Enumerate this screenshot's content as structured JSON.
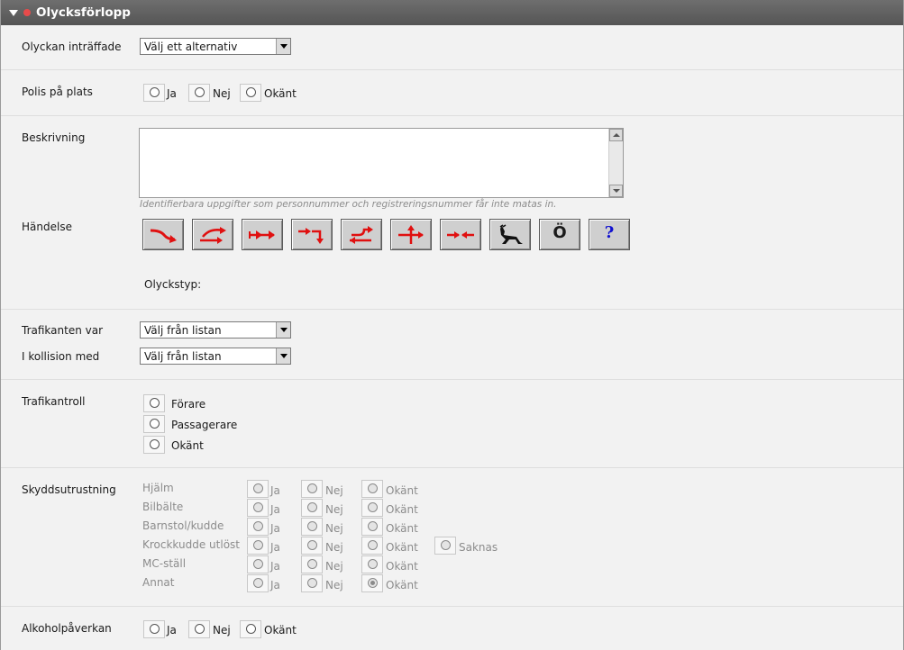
{
  "panel": {
    "title": "Olycksförlopp"
  },
  "incident": {
    "label": "Olyckan inträffade",
    "select_value": "Välj ett alternativ"
  },
  "police": {
    "label": "Polis på plats",
    "options": [
      "Ja",
      "Nej",
      "Okänt"
    ]
  },
  "description": {
    "label": "Beskrivning",
    "value": "",
    "hint": "Identifierbara uppgifter som personnummer och registreringsnummer får inte matas in."
  },
  "event": {
    "label": "Händelse",
    "buttons": [
      "turn-right-icon",
      "overtake-icon",
      "same-direction-icon",
      "turn-down-icon",
      "u-turn-icon",
      "crossing-icon",
      "head-on-icon",
      "deer-icon",
      "o-umlaut-icon",
      "question-icon"
    ],
    "glyph_o": "Ö",
    "glyph_q": "?",
    "type_label": "Olyckstyp:",
    "arrow_color": "#e01010"
  },
  "traffic_party": {
    "label": "Trafikanten var",
    "select_value": "Välj från listan"
  },
  "collision": {
    "label": "I kollision med",
    "select_value": "Välj från listan"
  },
  "traffic_control": {
    "label": "Trafikantroll",
    "options": [
      "Förare",
      "Passagerare",
      "Okänt"
    ]
  },
  "protection": {
    "label": "Skyddsutrustning",
    "options": [
      "Ja",
      "Nej",
      "Okänt"
    ],
    "missing_label": "Saknas",
    "rows": [
      "Hjälm",
      "Bilbälte",
      "Barnstol/kudde",
      "Krockkudde utlöst",
      "MC-ställ",
      "Annat"
    ],
    "selected_row": "Annat",
    "selected_option": "Okänt"
  },
  "alcohol": {
    "label": "Alkoholpåverkan",
    "options": [
      "Ja",
      "Nej",
      "Okänt"
    ]
  }
}
